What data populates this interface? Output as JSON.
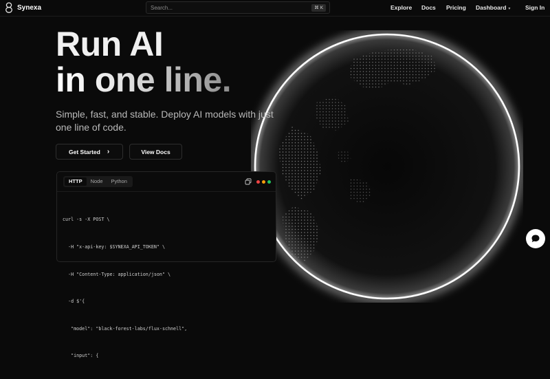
{
  "brand": {
    "name": "Synexa"
  },
  "search": {
    "placeholder": "Search...",
    "shortcut": "⌘ K"
  },
  "nav": {
    "links": [
      {
        "label": "Explore"
      },
      {
        "label": "Docs"
      },
      {
        "label": "Pricing"
      },
      {
        "label": "Dashboard"
      },
      {
        "label": "Sign In"
      }
    ]
  },
  "hero": {
    "title_line1": "Run AI",
    "title_line2": "in one line.",
    "subtitle": "Simple, fast, and stable. Deploy AI models with just one line of code.",
    "primary_button": "Get Started",
    "secondary_button": "View Docs"
  },
  "code_panel": {
    "tabs": [
      {
        "label": "HTTP",
        "active": true
      },
      {
        "label": "Node",
        "active": false
      },
      {
        "label": "Python",
        "active": false
      }
    ],
    "window_dots": [
      "#ef4444",
      "#f59e0b",
      "#22c55e"
    ],
    "lines": [
      "curl -s -X POST \\",
      "  -H \"x-api-key: $SYNEXA_API_TOKEN\" \\",
      "  -H \"Content-Type: application/json\" \\",
      "  -d $'{",
      "   \"model\": \"black-forest-labs/flux-schnell\",",
      "   \"input\": {"
    ]
  },
  "colors": {
    "background": "#0a0a0a",
    "text": "#ffffff",
    "muted": "#b9b9b9",
    "border": "#2e2e2e"
  },
  "icons": {
    "logo": "infinity-logo-icon",
    "copy": "copy-icon",
    "arrow": "chevron-right-icon",
    "dropdown": "chevron-down-icon",
    "chat": "chat-bubble-icon"
  }
}
